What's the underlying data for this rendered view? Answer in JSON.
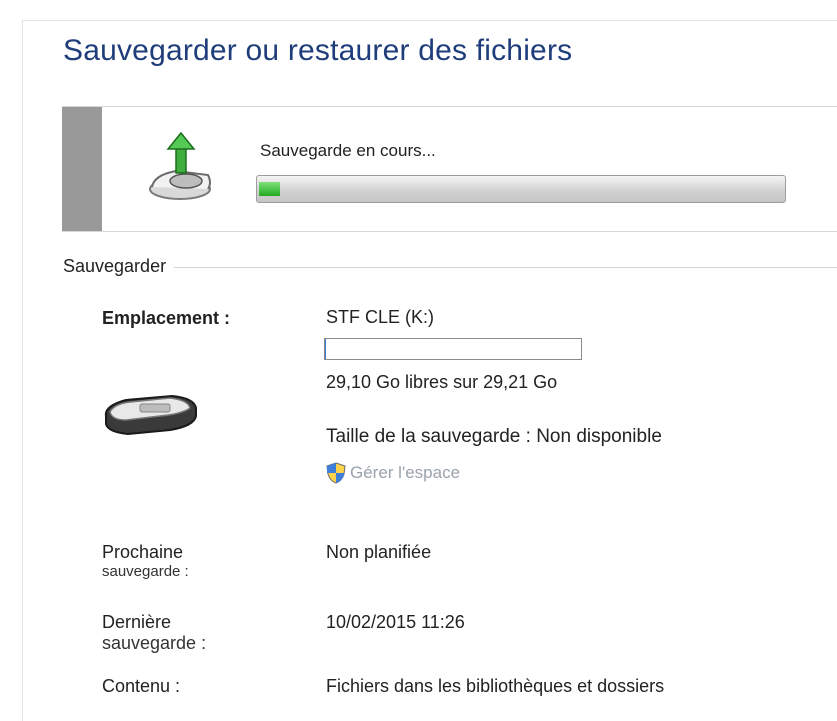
{
  "window": {
    "title": "Sauvegarder ou restaurer des fichiers"
  },
  "progress": {
    "label": "Sauvegarde en cours...",
    "percent": 4,
    "fill_color": "#22aa22"
  },
  "backup_section": {
    "header": "Sauvegarder",
    "location": {
      "label": "Emplacement :",
      "drive_name": "STF CLE (K:)",
      "used_fraction": 0.004,
      "free_space_text": "29,10 Go libres sur 29,21 Go"
    },
    "backup_size": "Taille de la sauvegarde : Non disponible",
    "manage_space_link": "Gérer l'espace",
    "next_backup": {
      "label_line1": "Prochaine",
      "label_line2": "sauvegarde :",
      "value": "Non planifiée"
    },
    "last_backup": {
      "label_line1": "Dernière",
      "label_line2": "sauvegarde :",
      "value": "10/02/2015 11:26"
    },
    "contents": {
      "label": "Contenu :",
      "value": "Fichiers dans les bibliothèques et dossiers"
    }
  },
  "icons": {
    "backup": "backup-arrow-drive-icon",
    "drive": "usb-drive-icon",
    "shield": "uac-shield-icon"
  },
  "colors": {
    "title": "#1f3d7a",
    "accent_bar": "#999999"
  }
}
